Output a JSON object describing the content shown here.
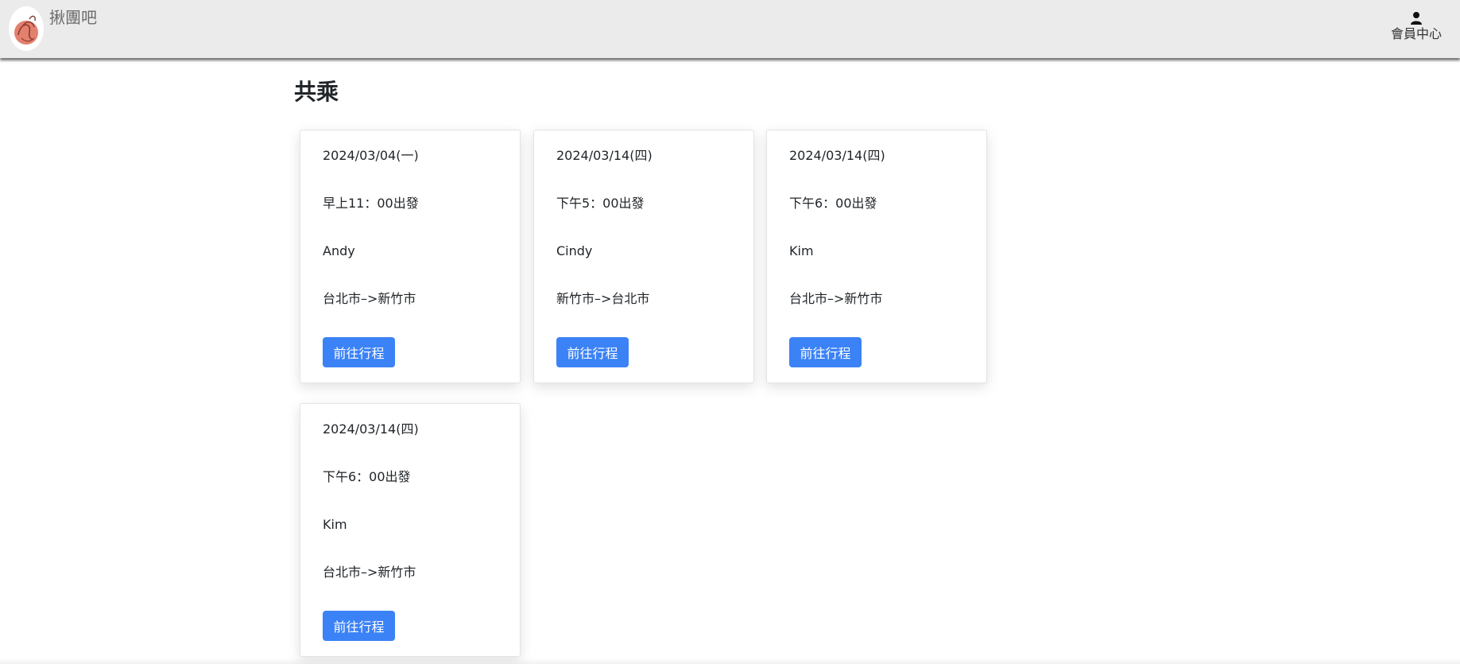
{
  "header": {
    "brand": "揪團吧",
    "member_label": "會員中心",
    "logo_icon": "swan-logo-icon",
    "member_icon": "user-icon"
  },
  "page": {
    "title": "共乘"
  },
  "rides": [
    {
      "date": "2024/03/04(一)",
      "time": "早上11：00出發",
      "driver": "Andy",
      "route": "台北市–>新竹市",
      "button": "前往行程"
    },
    {
      "date": "2024/03/14(四)",
      "time": "下午5：00出發",
      "driver": "Cindy",
      "route": "新竹市–>台北市",
      "button": "前往行程"
    },
    {
      "date": "2024/03/14(四)",
      "time": "下午6：00出發",
      "driver": "Kim",
      "route": "台北市–>新竹市",
      "button": "前往行程"
    },
    {
      "date": "2024/03/14(四)",
      "time": "下午6：00出發",
      "driver": "Kim",
      "route": "台北市–>新竹市",
      "button": "前往行程"
    }
  ],
  "colors": {
    "navbar_bg": "#ebebeb",
    "button_bg": "#3b82f6",
    "button_text": "#ffffff"
  }
}
